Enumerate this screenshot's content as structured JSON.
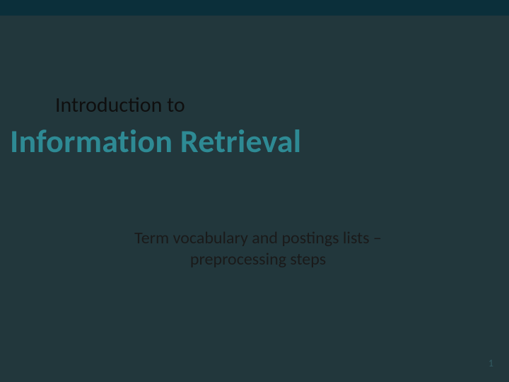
{
  "slide": {
    "pretitle": "Introduction to",
    "title": "Information Retrieval",
    "subtitle": "Term vocabulary and postings lists – preprocessing steps",
    "page_number": "1"
  }
}
